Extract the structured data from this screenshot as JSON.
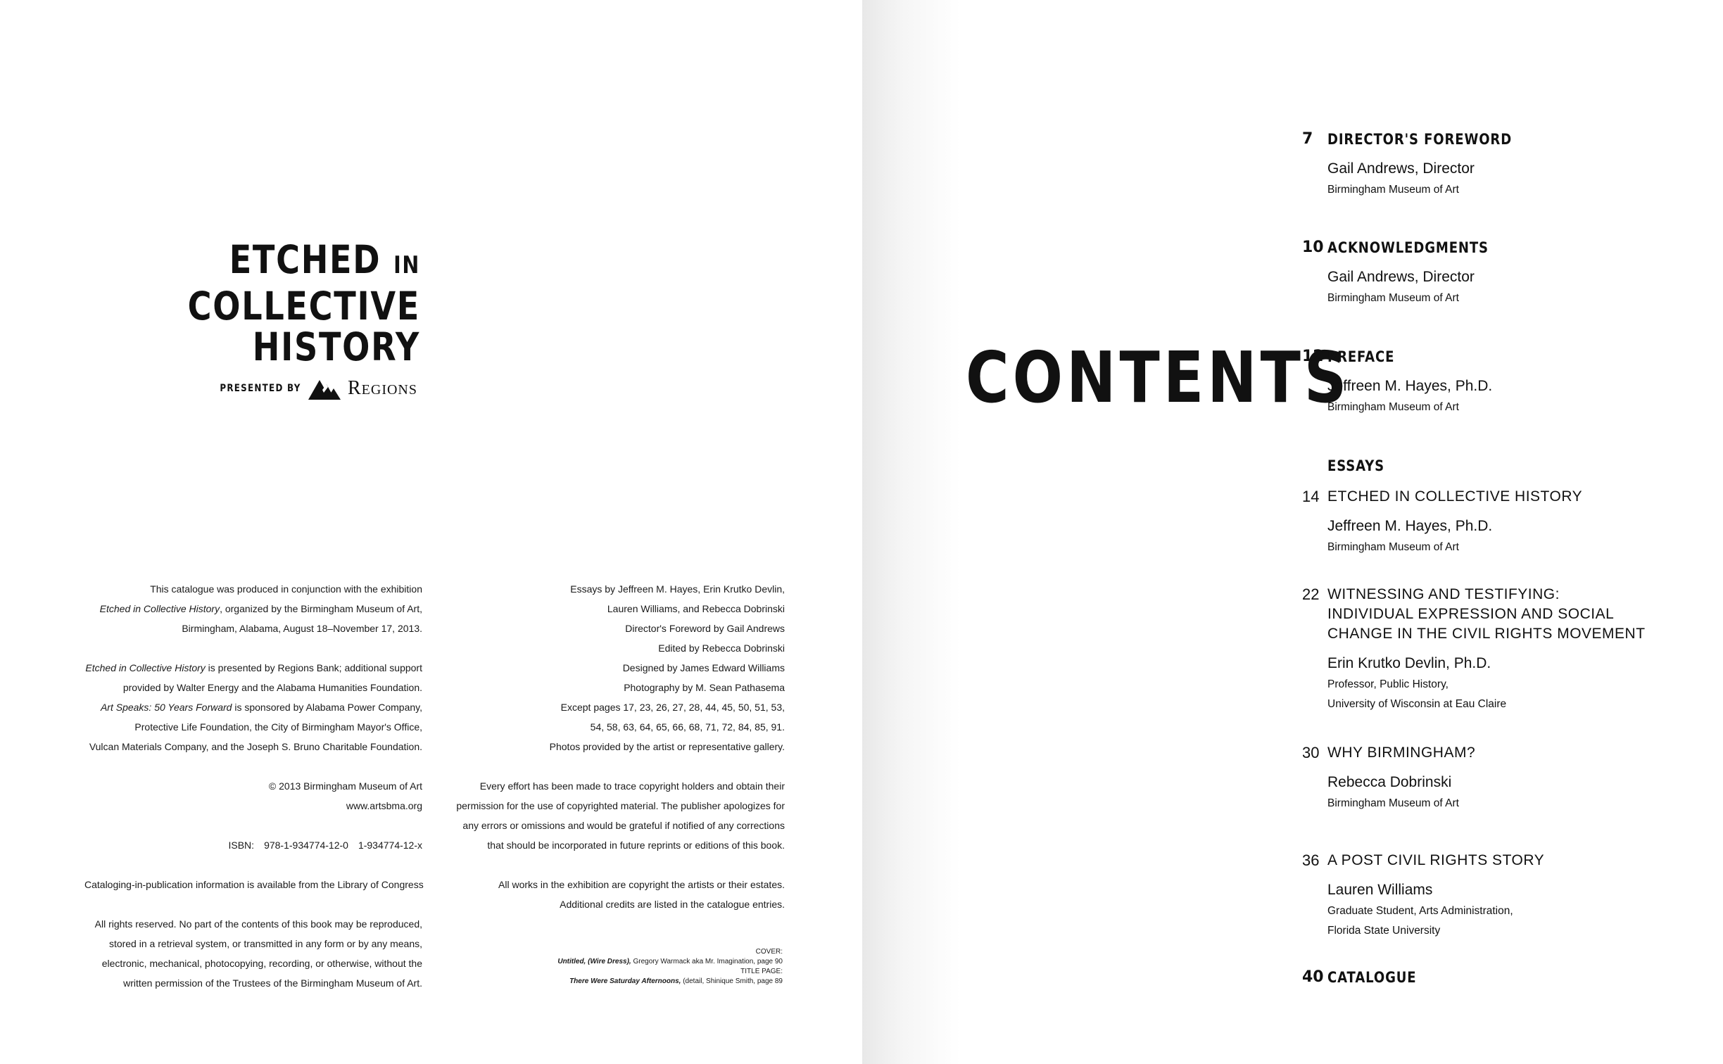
{
  "left_page": {
    "title": {
      "line1": "ETCHED",
      "line1_small": "IN",
      "line2": "COLLECTIVE",
      "line3": "HISTORY"
    },
    "presented_by": "PRESENTED BY",
    "sponsor_name": "Regions",
    "colophon_left": [
      "This catalogue was produced in conjunction with the exhibition",
      "Etched in Collective History, organized by the Birmingham Museum of Art,",
      "Birmingham, Alabama, August 18–November 17, 2013.",
      "",
      "Etched in Collective History is presented by Regions Bank; additional support",
      "provided by Walter Energy and the Alabama Humanities Foundation.",
      "Art Speaks: 50 Years Forward is sponsored by Alabama Power Company,",
      "Protective Life Foundation, the City of Birmingham Mayor's Office,",
      "Vulcan Materials Company, and the Joseph S. Bruno Charitable Foundation.",
      "",
      "© 2013 Birmingham Museum of Art",
      "www.artsbma.org",
      "",
      "",
      "",
      "Cataloging-in-publication information is available from the Library of Congress",
      "",
      "All rights reserved. No part of the contents of this book may be reproduced,",
      "stored in a retrieval system, or transmitted in any form or by any means,",
      "electronic, mechanical, photocopying, recording, or otherwise, without the",
      "written permission of the Trustees of the Birmingham Museum of Art."
    ],
    "isbn": {
      "label": "ISBN:",
      "isbn13": "978-1-934774-12-0",
      "isbn10": "1-934774-12-x"
    },
    "colophon_mid": [
      "Essays by Jeffreen M. Hayes, Erin Krutko Devlin,",
      "Lauren Williams, and Rebecca Dobrinski",
      "Director's Foreword by Gail Andrews",
      "Edited by Rebecca Dobrinski",
      "Designed by James Edward Williams",
      "Photography by M. Sean Pathasema",
      "Except pages 17, 23, 26, 27, 28, 44, 45, 50, 51, 53,",
      "54, 58, 63, 64, 65, 66, 68, 71, 72, 84, 85, 91.",
      "Photos provided by the artist or representative gallery.",
      "",
      "Every effort has been made to trace copyright holders and obtain their",
      "permission for the use of copyrighted material. The publisher apologizes for",
      "any errors or omissions and would be grateful if notified of any corrections",
      "that should be incorporated in future reprints or editions of this book.",
      "",
      "All works in the exhibition are copyright the artists or their estates.",
      "Additional credits are listed in the catalogue entries."
    ],
    "cover_credits": {
      "cover_label": "COVER:",
      "cover_work": "Untitled, (Wire Dress),",
      "cover_rest": " Gregory Warmack aka Mr. Imagination, page 90",
      "title_label": "TITLE PAGE:",
      "title_work": "There Were Saturday Afternoons,",
      "title_rest": " (detail, Shinique Smith, page 89"
    }
  },
  "right_page": {
    "heading": "CONTENTS",
    "toc": [
      {
        "page": "7",
        "title": "DIRECTOR'S FOREWORD",
        "bold": true,
        "author": "Gail Andrews, Director",
        "affiliation": [
          "Birmingham Museum of Art"
        ]
      },
      {
        "page": "10",
        "title": "ACKNOWLEDGMENTS",
        "bold": true,
        "author": "Gail Andrews, Director",
        "affiliation": [
          "Birmingham Museum of Art"
        ]
      },
      {
        "page": "12",
        "title": "PREFACE",
        "bold": true,
        "author": "Jeffreen M. Hayes, Ph.D.",
        "affiliation": [
          "Birmingham Museum of Art"
        ]
      },
      {
        "page": "",
        "title": "ESSAYS",
        "bold": true
      },
      {
        "page": "14",
        "title": "ETCHED IN COLLECTIVE HISTORY",
        "bold": false,
        "author": "Jeffreen M. Hayes, Ph.D.",
        "affiliation": [
          "Birmingham Museum of Art"
        ]
      },
      {
        "page": "22",
        "title_lines": [
          "WITNESSING AND TESTIFYING:",
          "INDIVIDUAL EXPRESSION AND SOCIAL",
          "CHANGE IN THE CIVIL RIGHTS MOVEMENT"
        ],
        "bold": false,
        "author": "Erin Krutko Devlin, Ph.D.",
        "affiliation": [
          "Professor, Public History,",
          "University of Wisconsin at Eau Claire"
        ]
      },
      {
        "page": "30",
        "title": "WHY BIRMINGHAM?",
        "bold": false,
        "author": "Rebecca Dobrinski",
        "affiliation": [
          "Birmingham Museum of Art"
        ]
      },
      {
        "page": "36",
        "title": "A POST CIVIL RIGHTS STORY",
        "bold": false,
        "author": "Lauren Williams",
        "affiliation": [
          "Graduate Student, Arts Administration,",
          "Florida State University"
        ]
      },
      {
        "page": "40",
        "title": "CATALOGUE",
        "bold": true
      }
    ]
  }
}
